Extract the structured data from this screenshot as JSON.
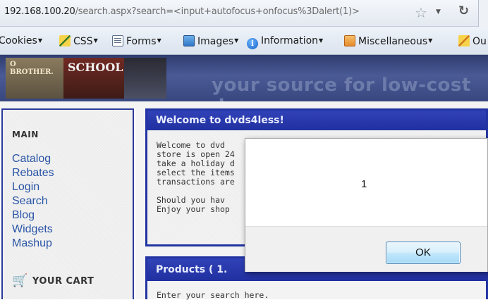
{
  "browser": {
    "url_host": "192.168.100.20",
    "url_path": "/search.aspx?search=<input+autofocus+onfocus%3Dalert(1)>",
    "icons": [
      "star-icon",
      "dropdown-icon",
      "reload-icon"
    ]
  },
  "toolbar": {
    "items": [
      {
        "label": "Cookies",
        "icon": "cookie-icon"
      },
      {
        "label": "CSS",
        "icon": "pencil-icon"
      },
      {
        "label": "Forms",
        "icon": "forms-icon"
      },
      {
        "label": "Images",
        "icon": "images-icon"
      },
      {
        "label": "Information",
        "icon": "information-icon"
      },
      {
        "label": "Miscellaneous",
        "icon": "toolbox-icon"
      },
      {
        "label": "Ou",
        "icon": "pencil-icon"
      }
    ]
  },
  "banner": {
    "image1_text": "O BROTHER.",
    "image2_text": "SCHOOL",
    "tagline": "your source for low-cost dv"
  },
  "sidebar": {
    "heading": "MAIN",
    "links": [
      "Catalog",
      "Rebates",
      "Login",
      "Search",
      "Blog",
      "Widgets",
      "Mashup"
    ],
    "cart_label": "YOUR CART",
    "link_color": "#2a55a6"
  },
  "welcome_panel": {
    "title": "Welcome to dvds4less!",
    "lines": [
      "Welcome to dvd",
      "store is open 24",
      "take a holiday d",
      "select the items",
      "transactions are",
      "",
      "Should you hav",
      "Enjoy your shop"
    ]
  },
  "products_panel": {
    "title": "Products ( 1.",
    "body": "Enter your search here."
  },
  "alert": {
    "message": "1",
    "ok_label": "OK"
  },
  "colors": {
    "panel_header": "#2233a2",
    "banner_bg": "#3a4880"
  }
}
